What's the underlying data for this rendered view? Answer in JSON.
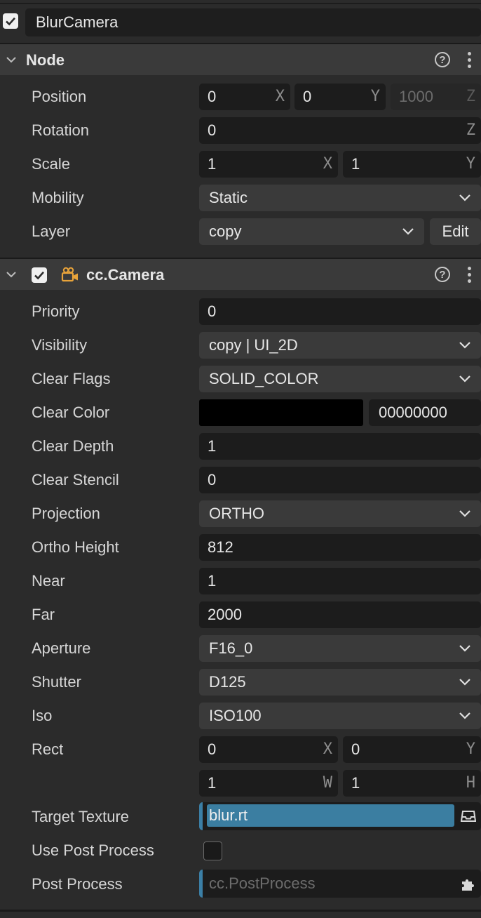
{
  "node_name": "BlurCamera",
  "node_section": {
    "title": "Node",
    "position": {
      "label": "Position",
      "x": "0",
      "y": "0",
      "z": "1000"
    },
    "rotation": {
      "label": "Rotation",
      "z": "0"
    },
    "scale": {
      "label": "Scale",
      "x": "1",
      "y": "1"
    },
    "mobility": {
      "label": "Mobility",
      "value": "Static"
    },
    "layer": {
      "label": "Layer",
      "value": "copy",
      "edit_label": "Edit"
    }
  },
  "camera_section": {
    "title": "cc.Camera",
    "enabled": true,
    "priority": {
      "label": "Priority",
      "value": "0"
    },
    "visibility": {
      "label": "Visibility",
      "value": "copy | UI_2D"
    },
    "clear_flags": {
      "label": "Clear Flags",
      "value": "SOLID_COLOR"
    },
    "clear_color": {
      "label": "Clear Color",
      "hex": "00000000",
      "swatch": "#000000"
    },
    "clear_depth": {
      "label": "Clear Depth",
      "value": "1"
    },
    "clear_stencil": {
      "label": "Clear Stencil",
      "value": "0"
    },
    "projection": {
      "label": "Projection",
      "value": "ORTHO"
    },
    "ortho_height": {
      "label": "Ortho Height",
      "value": "812"
    },
    "near": {
      "label": "Near",
      "value": "1"
    },
    "far": {
      "label": "Far",
      "value": "2000"
    },
    "aperture": {
      "label": "Aperture",
      "value": "F16_0"
    },
    "shutter": {
      "label": "Shutter",
      "value": "D125"
    },
    "iso": {
      "label": "Iso",
      "value": "ISO100"
    },
    "rect": {
      "label": "Rect",
      "x": "0",
      "y": "0",
      "w": "1",
      "h": "1"
    },
    "target_texture": {
      "label": "Target Texture",
      "value": "blur.rt"
    },
    "use_post_process": {
      "label": "Use Post Process",
      "checked": false
    },
    "post_process": {
      "label": "Post Process",
      "placeholder": "cc.PostProcess"
    }
  },
  "axis_letters": {
    "x": "X",
    "y": "Y",
    "z": "Z",
    "w": "W",
    "h": "H"
  },
  "help_glyph": "?",
  "colors": {
    "accent": "#3b7ea1",
    "camera_icon": "#e8a33a",
    "panel": "#2b2b2b",
    "field": "#1c1c1c"
  },
  "icons": [
    "checkbox-icon",
    "chevron-down-icon",
    "help-icon",
    "more-icon",
    "camera-icon",
    "asset-tray-icon",
    "puzzle-icon"
  ]
}
